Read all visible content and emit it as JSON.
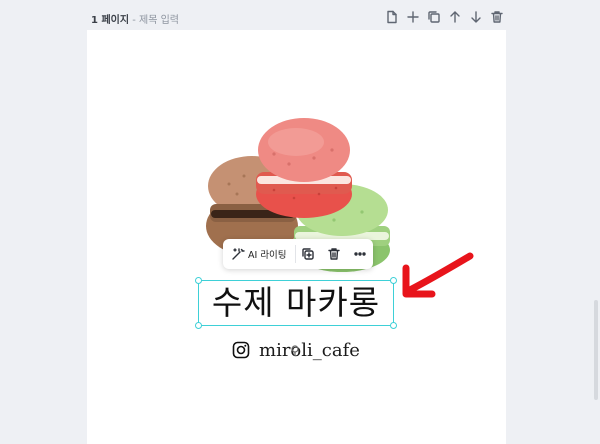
{
  "page_header": {
    "page_number": "1 페이지",
    "separator": " - ",
    "title_placeholder": "제목 입력"
  },
  "page_tools": [
    "new-page-icon",
    "add-icon",
    "duplicate-icon",
    "move-up-icon",
    "move-down-icon",
    "delete-icon"
  ],
  "floating_toolbar": {
    "ai_writing_label": "AI 라이팅",
    "buttons": [
      "duplicate-icon",
      "delete-icon",
      "more-icon"
    ]
  },
  "selected_text": "수제 마카롱",
  "instagram": {
    "icon": "instagram-icon",
    "handle": "miroli_cafe"
  },
  "annotation": {
    "arrow_color": "#e8141b"
  },
  "colors": {
    "selection": "#3ed0d7",
    "canvas": "#ffffff",
    "workspace": "#eef0f4"
  }
}
